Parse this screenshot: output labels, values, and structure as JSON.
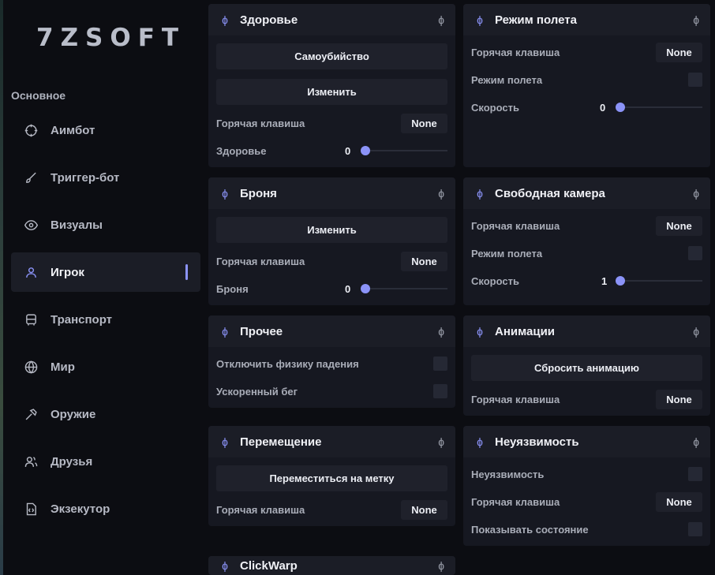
{
  "app": {
    "logo": "7ZSOFT"
  },
  "sidebar": {
    "section": "Основное",
    "items": [
      {
        "label": "Аимбот",
        "icon": "crosshair-icon"
      },
      {
        "label": "Триггер-бот",
        "icon": "brush-icon"
      },
      {
        "label": "Визуалы",
        "icon": "eye-icon"
      },
      {
        "label": "Игрок",
        "icon": "user-icon",
        "active": true
      },
      {
        "label": "Транспорт",
        "icon": "car-icon"
      },
      {
        "label": "Мир",
        "icon": "globe-icon"
      },
      {
        "label": "Оружие",
        "icon": "hammer-icon"
      },
      {
        "label": "Друзья",
        "icon": "users-icon"
      },
      {
        "label": "Экзекутор",
        "icon": "code-file-icon"
      }
    ]
  },
  "panels": {
    "health": {
      "title": "Здоровье",
      "suicide": "Самоубийство",
      "change": "Изменить",
      "hotkey_label": "Горячая клавиша",
      "hotkey": "None",
      "slider_label": "Здоровье",
      "slider_value": "0"
    },
    "armor": {
      "title": "Броня",
      "change": "Изменить",
      "hotkey_label": "Горячая клавиша",
      "hotkey": "None",
      "slider_label": "Броня",
      "slider_value": "0"
    },
    "other": {
      "title": "Прочее",
      "fall_label": "Отключить физику падения",
      "run_label": "Ускоренный бег"
    },
    "teleport": {
      "title": "Перемещение",
      "button": "Переместиться на метку",
      "hotkey_label": "Горячая клавиша",
      "hotkey": "None"
    },
    "clickwarp": {
      "title": "ClickWarp"
    },
    "fly": {
      "title": "Режим полета",
      "hotkey_label": "Горячая клавиша",
      "hotkey": "None",
      "mode_label": "Режим полета",
      "speed_label": "Скорость",
      "speed_value": "0"
    },
    "freecam": {
      "title": "Свободная камера",
      "hotkey_label": "Горячая клавиша",
      "hotkey": "None",
      "mode_label": "Режим полета",
      "speed_label": "Скорость",
      "speed_value": "1"
    },
    "anim": {
      "title": "Анимации",
      "button": "Сбросить анимацию",
      "hotkey_label": "Горячая клавиша",
      "hotkey": "None"
    },
    "god": {
      "title": "Неуязвимость",
      "god_label": "Неуязвимость",
      "hotkey_label": "Горячая клавиша",
      "hotkey": "None",
      "state_label": "Показывать состояние"
    }
  },
  "glyphs": {
    "panel_icon": "ɸ"
  },
  "colors": {
    "accent": "#8b93f8",
    "panel": "#161821",
    "header": "#1b1d26"
  }
}
